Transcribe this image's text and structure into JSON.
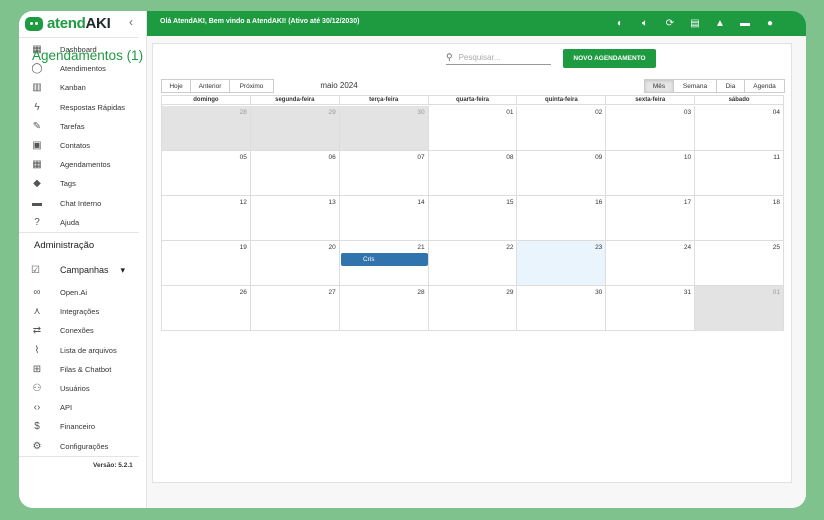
{
  "brand": {
    "name_part1": "atend",
    "name_part2": "AKI"
  },
  "sidebar": {
    "items": [
      {
        "label": "Dashboard",
        "icon": "grid-icon"
      },
      {
        "label": "Atendimentos",
        "icon": "whatsapp-icon"
      },
      {
        "label": "Kanban",
        "icon": "kanban-icon"
      },
      {
        "label": "Respostas Rápidas",
        "icon": "bolt-icon"
      },
      {
        "label": "Tarefas",
        "icon": "pencil-icon"
      },
      {
        "label": "Contatos",
        "icon": "contacts-icon"
      },
      {
        "label": "Agendamentos",
        "icon": "calendar-icon"
      },
      {
        "label": "Tags",
        "icon": "tag-icon"
      },
      {
        "label": "Chat Interno",
        "icon": "chat-icon"
      },
      {
        "label": "Ajuda",
        "icon": "help-icon"
      }
    ],
    "admin_title": "Administração",
    "campaigns_label": "Campanhas",
    "admin_items": [
      {
        "label": "Open.Ai",
        "icon": "infinity-icon"
      },
      {
        "label": "Integrações",
        "icon": "hub-icon"
      },
      {
        "label": "Conexões",
        "icon": "swap-icon"
      },
      {
        "label": "Lista de arquivos",
        "icon": "paperclip-icon"
      },
      {
        "label": "Filas & Chatbot",
        "icon": "tree-icon"
      },
      {
        "label": "Usuários",
        "icon": "users-icon"
      },
      {
        "label": "API",
        "icon": "code-icon"
      },
      {
        "label": "Financeiro",
        "icon": "money-icon"
      },
      {
        "label": "Configurações",
        "icon": "gear-icon"
      }
    ],
    "version": "Versão: 5.2.1"
  },
  "topbar": {
    "welcome": "Olá AtendAKI, Bem vindo a AtendAKI! (Ativo até 30/12/2030)"
  },
  "page": {
    "title": "Agendamentos (1)",
    "search_placeholder": "Pesquisar...",
    "new_button": "NOVO AGENDAMENTO"
  },
  "calendar": {
    "nav": {
      "today": "Hoje",
      "prev": "Anterior",
      "next": "Próximo"
    },
    "month_label": "maio 2024",
    "views": [
      "Mês",
      "Semana",
      "Dia",
      "Agenda"
    ],
    "active_view": "Mês",
    "weekdays": [
      "domingo",
      "segunda-feira",
      "terça-feira",
      "quarta-feira",
      "quinta-feira",
      "sexta-feira",
      "sábado"
    ],
    "weeks": [
      [
        {
          "d": "28",
          "off": true
        },
        {
          "d": "29",
          "off": true
        },
        {
          "d": "30",
          "off": true
        },
        {
          "d": "01"
        },
        {
          "d": "02"
        },
        {
          "d": "03"
        },
        {
          "d": "04"
        }
      ],
      [
        {
          "d": "05"
        },
        {
          "d": "06"
        },
        {
          "d": "07"
        },
        {
          "d": "08"
        },
        {
          "d": "09"
        },
        {
          "d": "10"
        },
        {
          "d": "11"
        }
      ],
      [
        {
          "d": "12"
        },
        {
          "d": "13"
        },
        {
          "d": "14"
        },
        {
          "d": "15"
        },
        {
          "d": "16"
        },
        {
          "d": "17"
        },
        {
          "d": "18"
        }
      ],
      [
        {
          "d": "19"
        },
        {
          "d": "20"
        },
        {
          "d": "21"
        },
        {
          "d": "22"
        },
        {
          "d": "23",
          "today": true
        },
        {
          "d": "24"
        },
        {
          "d": "25"
        }
      ],
      [
        {
          "d": "26"
        },
        {
          "d": "27"
        },
        {
          "d": "28"
        },
        {
          "d": "29"
        },
        {
          "d": "30"
        },
        {
          "d": "31"
        },
        {
          "d": "01",
          "off": true
        }
      ]
    ],
    "event": {
      "title": "Cris",
      "date": "21"
    },
    "colors": {
      "event": "#3174ad",
      "today": "#eaf4fd",
      "off_range": "#e3e3e3",
      "brand": "#1e9a40"
    }
  }
}
